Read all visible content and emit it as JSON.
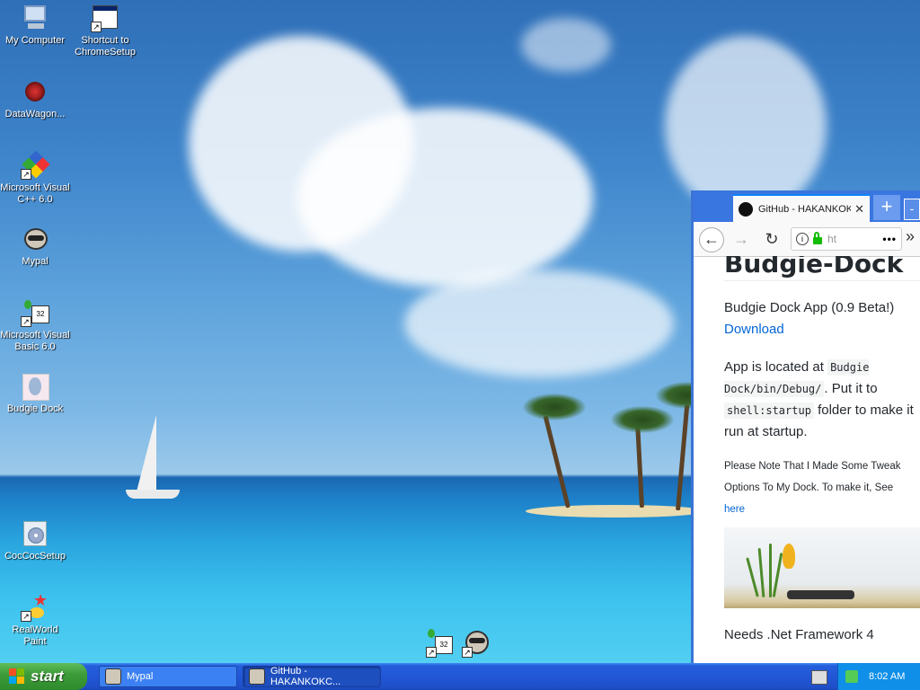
{
  "desktop": {
    "icons": [
      {
        "label": "My Computer",
        "icon": "my-computer-icon"
      },
      {
        "label": "Shortcut to ChromeSetup",
        "icon": "window-shortcut-icon"
      },
      {
        "label": "DataWagon...",
        "icon": "datawagon-icon"
      },
      {
        "label": "Microsoft Visual C++ 6.0",
        "icon": "visual-cpp-icon"
      },
      {
        "label": "Mypal",
        "icon": "mypal-raccoon-icon"
      },
      {
        "label": "Microsoft Visual Basic 6.0",
        "icon": "visual-basic-icon"
      },
      {
        "label": "Budgie Dock",
        "icon": "budgie-dock-icon"
      },
      {
        "label": "CocCocSetup",
        "icon": "coccoc-setup-icon"
      },
      {
        "label": "RealWorld Paint",
        "icon": "realworld-paint-icon"
      }
    ],
    "dock_icons": [
      "visual-basic-icon",
      "mypal-raccoon-icon"
    ]
  },
  "browser": {
    "tab_title": "GitHub - HAKANKOKC",
    "tab_close": "✕",
    "new_tab": "+",
    "minimize": "-",
    "url_text": "ht",
    "url_menu": "•••",
    "overflow": "»",
    "page": {
      "heading": "Budgie-Dock",
      "desc": "Budgie Dock App (0.9 Beta!)",
      "download_link": "Download",
      "p2_before": "App is located at ",
      "p2_code1": "Budgie Dock/bin/Debug/",
      "p2_mid": ". Put it to ",
      "p2_code2": "shell:startup",
      "p2_after": " folder to make it run at startup.",
      "note": "Please Note That I Made Some Tweak Options To My Dock. To make it, See ",
      "note_link": "here",
      "needs": "Needs .Net Framework 4"
    }
  },
  "taskbar": {
    "start_label": "start",
    "tasks": [
      {
        "label": "Mypal",
        "icon": "mypal-raccoon-icon",
        "active": false
      },
      {
        "label": "GitHub - HAKANKOKC...",
        "icon": "mypal-raccoon-icon",
        "active": true
      }
    ],
    "clock": "8:02 AM"
  },
  "colors": {
    "taskbar_blue": "#245edb",
    "start_green": "#3e9c3a",
    "browser_tab_bar": "#3a76e0",
    "link": "#0366d6"
  }
}
